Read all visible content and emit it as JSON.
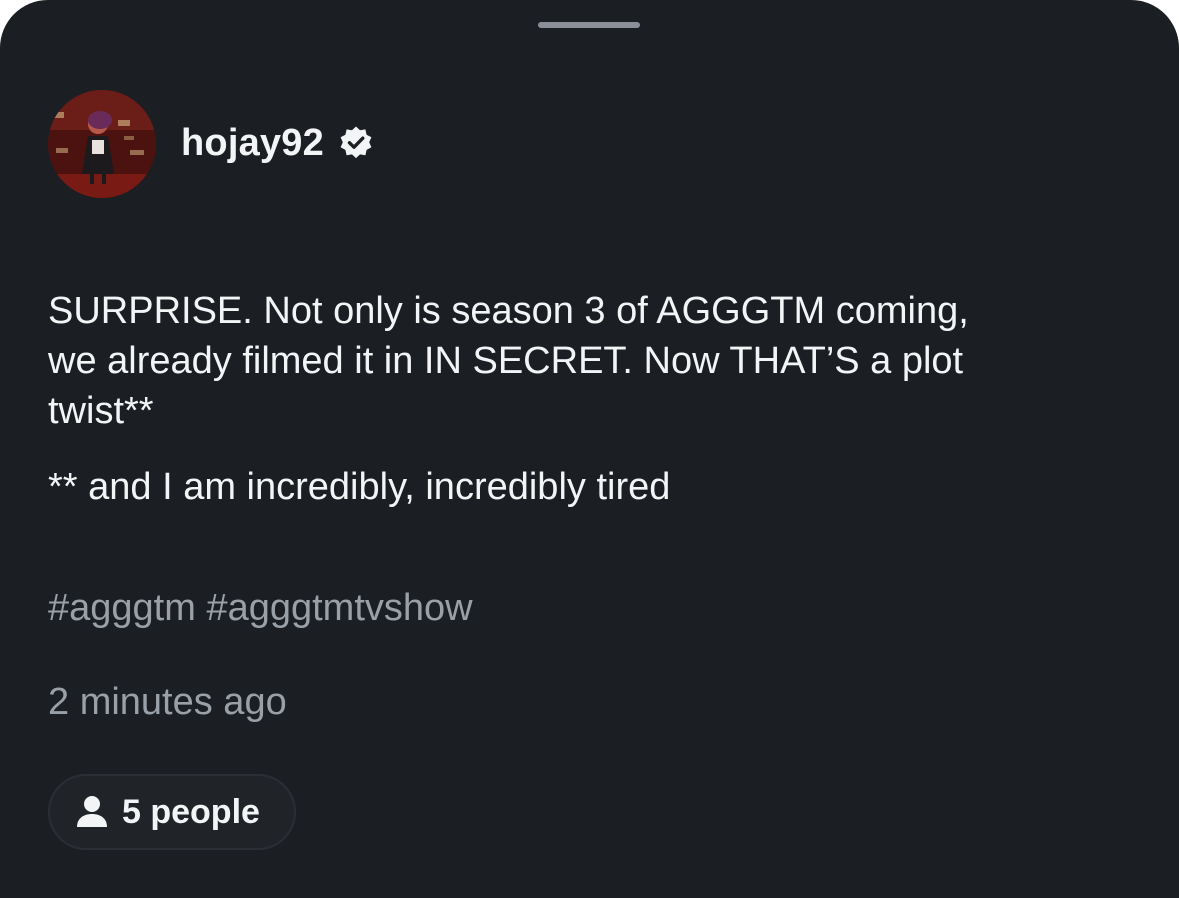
{
  "post": {
    "username": "hojay92",
    "verified": true,
    "body": {
      "paragraph1": "SURPRISE. Not only is season 3 of AGGGTM coming,\nwe already filmed it in IN SECRET. Now THAT’S a plot\ntwist**",
      "paragraph2": "** and I am incredibly, incredibly tired"
    },
    "hashtags": "#agggtm #agggtmtvshow",
    "timestamp": "2 minutes ago",
    "audience": {
      "icon": "person-icon",
      "label": "5 people"
    }
  },
  "colors": {
    "background": "#1b1e22",
    "primary_text": "#f3f4f6",
    "secondary_text": "#9aa0a8",
    "pill_background": "#202328"
  }
}
